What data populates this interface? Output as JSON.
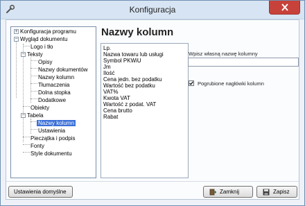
{
  "window": {
    "title": "Konfiguracja"
  },
  "tree": {
    "nodes": [
      {
        "label": "Konfiguracja programu",
        "toggle": "+"
      },
      {
        "label": "Wygląd dokumentu",
        "toggle": "−"
      },
      {
        "label": "Logo i tło"
      },
      {
        "label": "Teksty",
        "toggle": "−"
      },
      {
        "label": "Opisy"
      },
      {
        "label": "Nazwy dokumentów"
      },
      {
        "label": "Nazwy kolumn"
      },
      {
        "label": "Tłumaczenia"
      },
      {
        "label": "Dolna stopka"
      },
      {
        "label": "Dodatkowe"
      },
      {
        "label": "Obiekty"
      },
      {
        "label": "Tabela",
        "toggle": "−"
      },
      {
        "label": "Nazwy kolumn",
        "selected": true
      },
      {
        "label": "Ustawienia"
      },
      {
        "label": "Pieczątka i podpis"
      },
      {
        "label": "Fonty"
      },
      {
        "label": "Style dokumentu"
      }
    ]
  },
  "main": {
    "heading": "Nazwy kolumn",
    "columns": [
      "Lp.",
      "Nazwa towaru lub usługi",
      "Symbol PKWiU",
      "Jm",
      "Ilość",
      "Cena jedn. bez podatku",
      "Wartość bez podatku",
      "VAT%",
      "Kwota VAT",
      "Wartość z podat. VAT",
      "Cena brutto",
      "Rabat"
    ],
    "custom_name_label": "Wpisz własną nazwę kolumny",
    "custom_name_value": "",
    "bold_headers_label": "Pogrubione nagłówki kolumn",
    "bold_headers_checked": true
  },
  "buttons": {
    "defaults": "Ustawienia domyślne",
    "close": "Zamknij",
    "save": "Zapisz"
  },
  "colors": {
    "titlebar": "#d7e4f3",
    "close_button": "#c7423a",
    "selection": "#3a6fd8"
  }
}
